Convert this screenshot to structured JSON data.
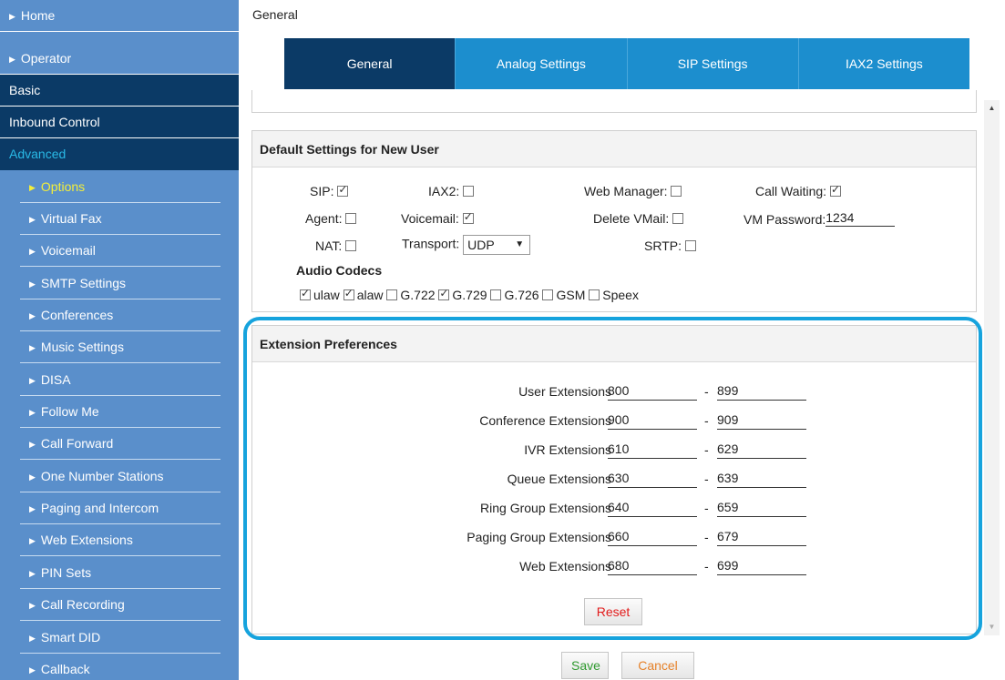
{
  "breadcrumb": "General",
  "sidebar": {
    "top_items": [
      {
        "label": "Home"
      },
      {
        "label": "Operator"
      }
    ],
    "sections": [
      {
        "label": "Basic"
      },
      {
        "label": "Inbound Control"
      },
      {
        "label": "Advanced"
      }
    ],
    "sub_items": [
      {
        "label": "Options"
      },
      {
        "label": "Virtual Fax"
      },
      {
        "label": "Voicemail"
      },
      {
        "label": "SMTP Settings"
      },
      {
        "label": "Conferences"
      },
      {
        "label": "Music Settings"
      },
      {
        "label": "DISA"
      },
      {
        "label": "Follow Me"
      },
      {
        "label": "Call Forward"
      },
      {
        "label": "One Number Stations"
      },
      {
        "label": "Paging and Intercom"
      },
      {
        "label": "Web Extensions"
      },
      {
        "label": "PIN Sets"
      },
      {
        "label": "Call Recording"
      },
      {
        "label": "Smart DID"
      },
      {
        "label": "Callback"
      }
    ]
  },
  "tabs": [
    {
      "label": "General"
    },
    {
      "label": "Analog Settings"
    },
    {
      "label": "SIP Settings"
    },
    {
      "label": "IAX2 Settings"
    }
  ],
  "defaults": {
    "title": "Default Settings for New User",
    "sip_label": "SIP:",
    "iax2_label": "IAX2:",
    "web_manager_label": "Web Manager:",
    "call_waiting_label": "Call Waiting:",
    "agent_label": "Agent:",
    "voicemail_label": "Voicemail:",
    "delete_vmail_label": "Delete VMail:",
    "vm_password_label": "VM Password:",
    "vm_password_value": "1234",
    "nat_label": "NAT:",
    "transport_label": "Transport:",
    "transport_value": "UDP",
    "srtp_label": "SRTP:",
    "audio_codecs_label": "Audio Codecs",
    "codecs": [
      {
        "label": "ulaw"
      },
      {
        "label": "alaw"
      },
      {
        "label": "G.722"
      },
      {
        "label": "G.729"
      },
      {
        "label": "G.726"
      },
      {
        "label": "GSM"
      },
      {
        "label": "Speex"
      }
    ]
  },
  "extensions": {
    "title": "Extension Preferences",
    "dash": "-",
    "rows": [
      {
        "label": "User Extensions",
        "from": "800",
        "to": "899"
      },
      {
        "label": "Conference Extensions",
        "from": "900",
        "to": "909"
      },
      {
        "label": "IVR Extensions",
        "from": "610",
        "to": "629"
      },
      {
        "label": "Queue Extensions",
        "from": "630",
        "to": "639"
      },
      {
        "label": "Ring Group Extensions",
        "from": "640",
        "to": "659"
      },
      {
        "label": "Paging Group Extensions",
        "from": "660",
        "to": "679"
      },
      {
        "label": "Web Extensions",
        "from": "680",
        "to": "699"
      }
    ],
    "reset_label": "Reset"
  },
  "actions": {
    "save_label": "Save",
    "cancel_label": "Cancel"
  },
  "colors": {
    "sidebar_bg": "#5a8fcb",
    "sidebar_dark": "#0b3a66",
    "tab_bg": "#1c8ece",
    "highlight": "#16a3dd"
  }
}
